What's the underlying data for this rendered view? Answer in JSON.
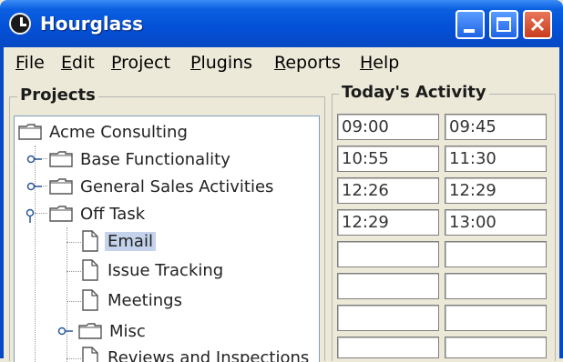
{
  "window": {
    "title": "Hourglass"
  },
  "menu": [
    "File",
    "Edit",
    "Project",
    "Plugins",
    "Reports",
    "Help"
  ],
  "projects": {
    "heading": "Projects",
    "tree": [
      {
        "label": "Acme Consulting",
        "kind": "folder",
        "depth": 0
      },
      {
        "label": "Base Functionality",
        "kind": "folder",
        "depth": 1,
        "expanded": false
      },
      {
        "label": "General Sales Activities",
        "kind": "folder",
        "depth": 1,
        "expanded": false
      },
      {
        "label": "Off Task",
        "kind": "folder",
        "depth": 1,
        "expanded": true
      },
      {
        "label": "Email",
        "kind": "document",
        "depth": 2,
        "selected": true
      },
      {
        "label": "Issue Tracking",
        "kind": "document",
        "depth": 2
      },
      {
        "label": "Meetings",
        "kind": "document",
        "depth": 2
      },
      {
        "label": "Misc",
        "kind": "folder",
        "depth": 2,
        "expanded": false
      },
      {
        "label": "Reviews and Inspections",
        "kind": "document",
        "depth": 2
      }
    ]
  },
  "activity": {
    "heading": "Today's Activity",
    "rows": [
      {
        "start": "09:00",
        "end": "09:45"
      },
      {
        "start": "10:55",
        "end": "11:30"
      },
      {
        "start": "12:26",
        "end": "12:29"
      },
      {
        "start": "12:29",
        "end": "13:00"
      },
      {
        "start": "",
        "end": ""
      },
      {
        "start": "",
        "end": ""
      },
      {
        "start": "",
        "end": ""
      },
      {
        "start": "",
        "end": ""
      }
    ]
  },
  "colors": {
    "titlebar": "#0450d6",
    "selection": "#c4d3eb",
    "window_bg": "#ece9d8"
  }
}
